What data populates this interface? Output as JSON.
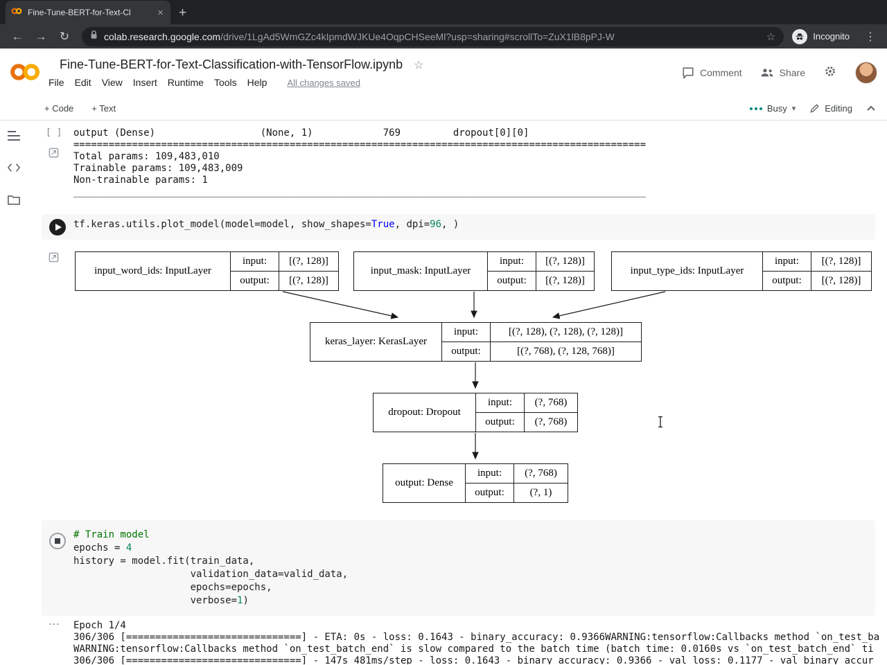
{
  "colors": {
    "colab_orange": "#F9AB00",
    "colab_dark_orange": "#E8710A",
    "busy_dots": "#00897b",
    "keyword_blue": "#0000ff",
    "number_green": "#098658",
    "comment_green": "#007400"
  },
  "icons": {
    "close": "×",
    "new_tab": "+",
    "back": "←",
    "forward": "→",
    "reload": "↻",
    "star": "☆",
    "kebab": "⋮",
    "dropdown": "▾",
    "overflow": "⋯",
    "code_snippets": "<>"
  },
  "browser": {
    "tab_title": "Fine-Tune-BERT-for-Text-Cl",
    "url_domain": "colab.research.google.com",
    "url_path": "/drive/1LgAd5WmGZc4kIpmdWJKUe4OqpCHSeeMl?usp=sharing#scrollTo=ZuX1lB8pPJ-W",
    "incognito_label": "Incognito"
  },
  "header": {
    "title": "Fine-Tune-BERT-for-Text-Classification-with-TensorFlow.ipynb",
    "menus": [
      "File",
      "Edit",
      "View",
      "Insert",
      "Runtime",
      "Tools",
      "Help"
    ],
    "save_status": "All changes saved",
    "comment": "Comment",
    "share": "Share"
  },
  "toolbar": {
    "add_code": "+ Code",
    "add_text": "+ Text",
    "busy": "Busy",
    "editing": "Editing"
  },
  "summary_output": {
    "bracket": "[ ]",
    "lines": [
      "output (Dense)                  (None, 1)            769         dropout[0][0]",
      "==================================================================================================",
      "Total params: 109,483,010",
      "Trainable params: 109,483,009",
      "Non-trainable params: 1",
      "__________________________________________________________________________________________________"
    ]
  },
  "plot_cell": {
    "lines": [
      [
        {
          "t": "tf.keras.utils.plot_model(model=model, show_shapes=",
          "c": "plain"
        },
        {
          "t": "True",
          "c": "kw"
        },
        {
          "t": ", dpi=",
          "c": "plain"
        },
        {
          "t": "96",
          "c": "num"
        },
        {
          "t": ", )",
          "c": "plain"
        }
      ]
    ]
  },
  "diagram": {
    "labels": {
      "input": "input:",
      "output": "output:"
    },
    "nodes": [
      {
        "name": "input_word_ids: InputLayer",
        "input": "[(?, 128)]",
        "output": "[(?, 128)]"
      },
      {
        "name": "input_mask: InputLayer",
        "input": "[(?, 128)]",
        "output": "[(?, 128)]"
      },
      {
        "name": "input_type_ids: InputLayer",
        "input": "[(?, 128)]",
        "output": "[(?, 128)]"
      },
      {
        "name": "keras_layer: KerasLayer",
        "input": "[(?, 128), (?, 128), (?, 128)]",
        "output": "[(?, 768), (?, 128, 768)]"
      },
      {
        "name": "dropout: Dropout",
        "input": "(?, 768)",
        "output": "(?, 768)"
      },
      {
        "name": "output: Dense",
        "input": "(?, 768)",
        "output": "(?, 1)"
      }
    ]
  },
  "train_cell": {
    "lines": [
      [
        {
          "t": "# Train model",
          "c": "comment"
        }
      ],
      [
        {
          "t": "epochs = ",
          "c": "plain"
        },
        {
          "t": "4",
          "c": "num"
        }
      ],
      [
        {
          "t": "history = model.fit(train_data,",
          "c": "plain"
        }
      ],
      [
        {
          "t": "                    validation_data=valid_data,",
          "c": "plain"
        }
      ],
      [
        {
          "t": "                    epochs=epochs,",
          "c": "plain"
        }
      ],
      [
        {
          "t": "                    verbose=",
          "c": "plain"
        },
        {
          "t": "1",
          "c": "num"
        },
        {
          "t": ")",
          "c": "plain"
        }
      ]
    ]
  },
  "train_output": {
    "lines": [
      "Epoch 1/4",
      "306/306 [==============================] - ETA: 0s - loss: 0.1643 - binary_accuracy: 0.9366WARNING:tensorflow:Callbacks method `on_test_ba",
      "WARNING:tensorflow:Callbacks method `on_test_batch_end` is slow compared to the batch time (batch time: 0.0160s vs `on_test_batch_end` ti",
      "306/306 [==============================] - 147s 481ms/step - loss: 0.1643 - binary_accuracy: 0.9366 - val_loss: 0.1177 - val_binary_accur"
    ]
  }
}
